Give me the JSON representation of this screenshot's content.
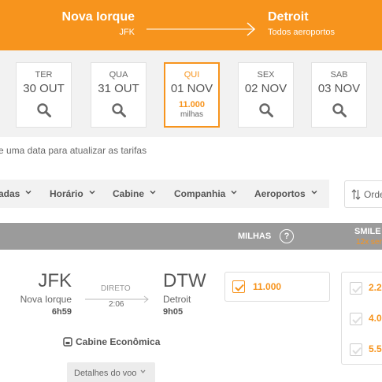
{
  "route": {
    "origin_city": "Nova Iorque",
    "origin_code": "JFK",
    "destination_city": "Detroit",
    "destination_code": "Todos aeroportos"
  },
  "dates": [
    {
      "dow": "TER",
      "date": "30 OUT",
      "icon": "search-icon"
    },
    {
      "dow": "QUA",
      "date": "31 OUT",
      "icon": "search-icon"
    },
    {
      "dow": "QUI",
      "date": "01 NOV",
      "price": "11.000",
      "unit": "milhas",
      "selected": true
    },
    {
      "dow": "SEX",
      "date": "02 NOV",
      "icon": "search-icon"
    },
    {
      "dow": "SAB",
      "date": "03 NOV",
      "icon": "search-icon"
    }
  ],
  "hint": "e uma data para atualizar as tarifas",
  "filters": {
    "items": [
      "adas",
      "Horário",
      "Cabine",
      "Companhia",
      "Aeroportos"
    ],
    "sort_label": "Orde"
  },
  "columns": {
    "miles": "MILHAS",
    "help": "?",
    "smiles": "SMILE",
    "smiles_sub": "12x ser"
  },
  "flight": {
    "origin_code": "JFK",
    "origin_city": "Nova Iorque",
    "departure": "6h59",
    "stops": "DIRETO",
    "duration": "2:06",
    "destination_code": "DTW",
    "destination_city": "Detroit",
    "arrival": "9h05",
    "cabin": "Cabine Econômica",
    "details_label": "Detalhes do voo",
    "fare_miles": "11.000",
    "smiles_fares": [
      "2.2",
      "4.0",
      "5.5"
    ]
  },
  "colors": {
    "accent": "#f7941d",
    "header_gray": "#9b9b9b",
    "strip_bg": "#f2f2f2"
  }
}
